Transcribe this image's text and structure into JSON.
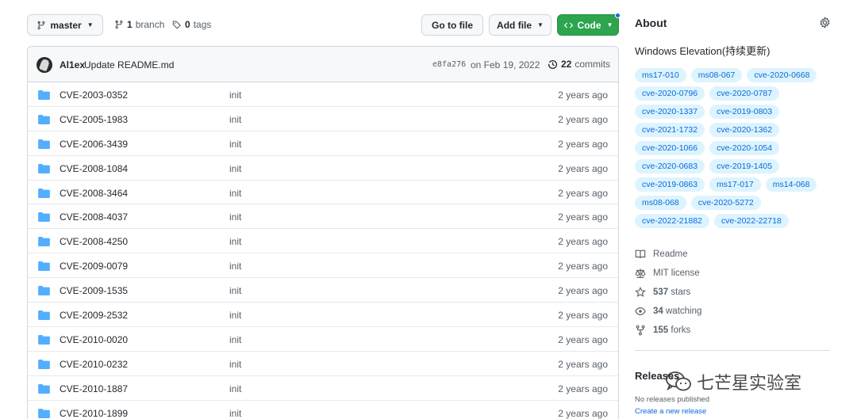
{
  "toolbar": {
    "branch_name": "master",
    "branch_count": "1",
    "branch_label": "branch",
    "tag_count": "0",
    "tag_label": "tags",
    "goto_file": "Go to file",
    "add_file": "Add file",
    "code": "Code"
  },
  "commit": {
    "author": "Al1ex",
    "message": "Update README.md",
    "hash": "e8fa276",
    "date": "on Feb 19, 2022",
    "count": "22",
    "count_label": "commits"
  },
  "files": [
    {
      "name": "CVE-2003-0352",
      "message": "init",
      "age": "2 years ago"
    },
    {
      "name": "CVE-2005-1983",
      "message": "init",
      "age": "2 years ago"
    },
    {
      "name": "CVE-2006-3439",
      "message": "init",
      "age": "2 years ago"
    },
    {
      "name": "CVE-2008-1084",
      "message": "init",
      "age": "2 years ago"
    },
    {
      "name": "CVE-2008-3464",
      "message": "init",
      "age": "2 years ago"
    },
    {
      "name": "CVE-2008-4037",
      "message": "init",
      "age": "2 years ago"
    },
    {
      "name": "CVE-2008-4250",
      "message": "init",
      "age": "2 years ago"
    },
    {
      "name": "CVE-2009-0079",
      "message": "init",
      "age": "2 years ago"
    },
    {
      "name": "CVE-2009-1535",
      "message": "init",
      "age": "2 years ago"
    },
    {
      "name": "CVE-2009-2532",
      "message": "init",
      "age": "2 years ago"
    },
    {
      "name": "CVE-2010-0020",
      "message": "init",
      "age": "2 years ago"
    },
    {
      "name": "CVE-2010-0232",
      "message": "init",
      "age": "2 years ago"
    },
    {
      "name": "CVE-2010-1887",
      "message": "init",
      "age": "2 years ago"
    },
    {
      "name": "CVE-2010-1899",
      "message": "init",
      "age": "2 years ago"
    }
  ],
  "about": {
    "title": "About",
    "description": "Windows Elevation(持续更新)",
    "topics": [
      "ms17-010",
      "ms08-067",
      "cve-2020-0668",
      "cve-2020-0796",
      "cve-2020-0787",
      "cve-2020-1337",
      "cve-2019-0803",
      "cve-2021-1732",
      "cve-2020-1362",
      "cve-2020-1066",
      "cve-2020-1054",
      "cve-2020-0683",
      "cve-2019-1405",
      "cve-2019-0863",
      "ms17-017",
      "ms14-068",
      "ms08-068",
      "cve-2020-5272",
      "cve-2022-21882",
      "cve-2022-22718"
    ],
    "readme": "Readme",
    "license": "MIT license",
    "stars_count": "537",
    "stars_label": "stars",
    "watching_count": "34",
    "watching_label": "watching",
    "forks_count": "155",
    "forks_label": "forks"
  },
  "releases": {
    "title": "Releases",
    "none": "No releases published",
    "create": "Create a new release"
  },
  "watermark": {
    "text": "七芒星实验室"
  },
  "colors": {
    "accent_green": "#2da44e",
    "link_blue": "#0969da",
    "folder_blue": "#54aeff",
    "topic_bg": "#ddf4ff"
  }
}
